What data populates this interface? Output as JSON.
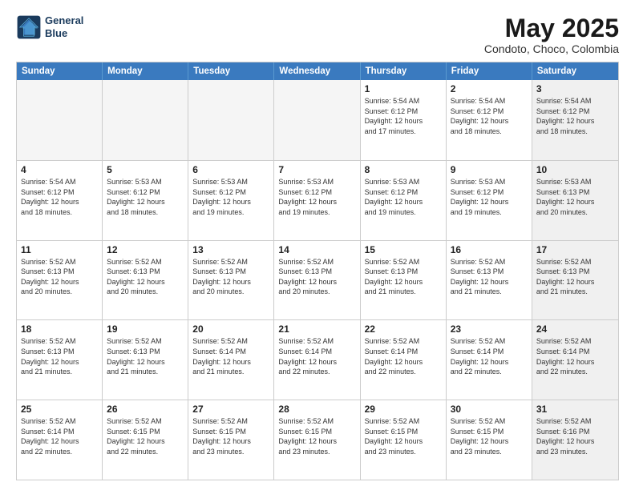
{
  "logo": {
    "line1": "General",
    "line2": "Blue"
  },
  "title": "May 2025",
  "subtitle": "Condoto, Choco, Colombia",
  "header_days": [
    "Sunday",
    "Monday",
    "Tuesday",
    "Wednesday",
    "Thursday",
    "Friday",
    "Saturday"
  ],
  "weeks": [
    [
      {
        "day": "",
        "info": "",
        "shaded": true
      },
      {
        "day": "",
        "info": "",
        "shaded": true
      },
      {
        "day": "",
        "info": "",
        "shaded": true
      },
      {
        "day": "",
        "info": "",
        "shaded": true
      },
      {
        "day": "1",
        "info": "Sunrise: 5:54 AM\nSunset: 6:12 PM\nDaylight: 12 hours\nand 17 minutes."
      },
      {
        "day": "2",
        "info": "Sunrise: 5:54 AM\nSunset: 6:12 PM\nDaylight: 12 hours\nand 18 minutes."
      },
      {
        "day": "3",
        "info": "Sunrise: 5:54 AM\nSunset: 6:12 PM\nDaylight: 12 hours\nand 18 minutes.",
        "shaded": true
      }
    ],
    [
      {
        "day": "4",
        "info": "Sunrise: 5:54 AM\nSunset: 6:12 PM\nDaylight: 12 hours\nand 18 minutes."
      },
      {
        "day": "5",
        "info": "Sunrise: 5:53 AM\nSunset: 6:12 PM\nDaylight: 12 hours\nand 18 minutes."
      },
      {
        "day": "6",
        "info": "Sunrise: 5:53 AM\nSunset: 6:12 PM\nDaylight: 12 hours\nand 19 minutes."
      },
      {
        "day": "7",
        "info": "Sunrise: 5:53 AM\nSunset: 6:12 PM\nDaylight: 12 hours\nand 19 minutes."
      },
      {
        "day": "8",
        "info": "Sunrise: 5:53 AM\nSunset: 6:12 PM\nDaylight: 12 hours\nand 19 minutes."
      },
      {
        "day": "9",
        "info": "Sunrise: 5:53 AM\nSunset: 6:12 PM\nDaylight: 12 hours\nand 19 minutes."
      },
      {
        "day": "10",
        "info": "Sunrise: 5:53 AM\nSunset: 6:13 PM\nDaylight: 12 hours\nand 20 minutes.",
        "shaded": true
      }
    ],
    [
      {
        "day": "11",
        "info": "Sunrise: 5:52 AM\nSunset: 6:13 PM\nDaylight: 12 hours\nand 20 minutes."
      },
      {
        "day": "12",
        "info": "Sunrise: 5:52 AM\nSunset: 6:13 PM\nDaylight: 12 hours\nand 20 minutes."
      },
      {
        "day": "13",
        "info": "Sunrise: 5:52 AM\nSunset: 6:13 PM\nDaylight: 12 hours\nand 20 minutes."
      },
      {
        "day": "14",
        "info": "Sunrise: 5:52 AM\nSunset: 6:13 PM\nDaylight: 12 hours\nand 20 minutes."
      },
      {
        "day": "15",
        "info": "Sunrise: 5:52 AM\nSunset: 6:13 PM\nDaylight: 12 hours\nand 21 minutes."
      },
      {
        "day": "16",
        "info": "Sunrise: 5:52 AM\nSunset: 6:13 PM\nDaylight: 12 hours\nand 21 minutes."
      },
      {
        "day": "17",
        "info": "Sunrise: 5:52 AM\nSunset: 6:13 PM\nDaylight: 12 hours\nand 21 minutes.",
        "shaded": true
      }
    ],
    [
      {
        "day": "18",
        "info": "Sunrise: 5:52 AM\nSunset: 6:13 PM\nDaylight: 12 hours\nand 21 minutes."
      },
      {
        "day": "19",
        "info": "Sunrise: 5:52 AM\nSunset: 6:13 PM\nDaylight: 12 hours\nand 21 minutes."
      },
      {
        "day": "20",
        "info": "Sunrise: 5:52 AM\nSunset: 6:14 PM\nDaylight: 12 hours\nand 21 minutes."
      },
      {
        "day": "21",
        "info": "Sunrise: 5:52 AM\nSunset: 6:14 PM\nDaylight: 12 hours\nand 22 minutes."
      },
      {
        "day": "22",
        "info": "Sunrise: 5:52 AM\nSunset: 6:14 PM\nDaylight: 12 hours\nand 22 minutes."
      },
      {
        "day": "23",
        "info": "Sunrise: 5:52 AM\nSunset: 6:14 PM\nDaylight: 12 hours\nand 22 minutes."
      },
      {
        "day": "24",
        "info": "Sunrise: 5:52 AM\nSunset: 6:14 PM\nDaylight: 12 hours\nand 22 minutes.",
        "shaded": true
      }
    ],
    [
      {
        "day": "25",
        "info": "Sunrise: 5:52 AM\nSunset: 6:14 PM\nDaylight: 12 hours\nand 22 minutes."
      },
      {
        "day": "26",
        "info": "Sunrise: 5:52 AM\nSunset: 6:15 PM\nDaylight: 12 hours\nand 22 minutes."
      },
      {
        "day": "27",
        "info": "Sunrise: 5:52 AM\nSunset: 6:15 PM\nDaylight: 12 hours\nand 23 minutes."
      },
      {
        "day": "28",
        "info": "Sunrise: 5:52 AM\nSunset: 6:15 PM\nDaylight: 12 hours\nand 23 minutes."
      },
      {
        "day": "29",
        "info": "Sunrise: 5:52 AM\nSunset: 6:15 PM\nDaylight: 12 hours\nand 23 minutes."
      },
      {
        "day": "30",
        "info": "Sunrise: 5:52 AM\nSunset: 6:15 PM\nDaylight: 12 hours\nand 23 minutes."
      },
      {
        "day": "31",
        "info": "Sunrise: 5:52 AM\nSunset: 6:16 PM\nDaylight: 12 hours\nand 23 minutes.",
        "shaded": true
      }
    ]
  ]
}
